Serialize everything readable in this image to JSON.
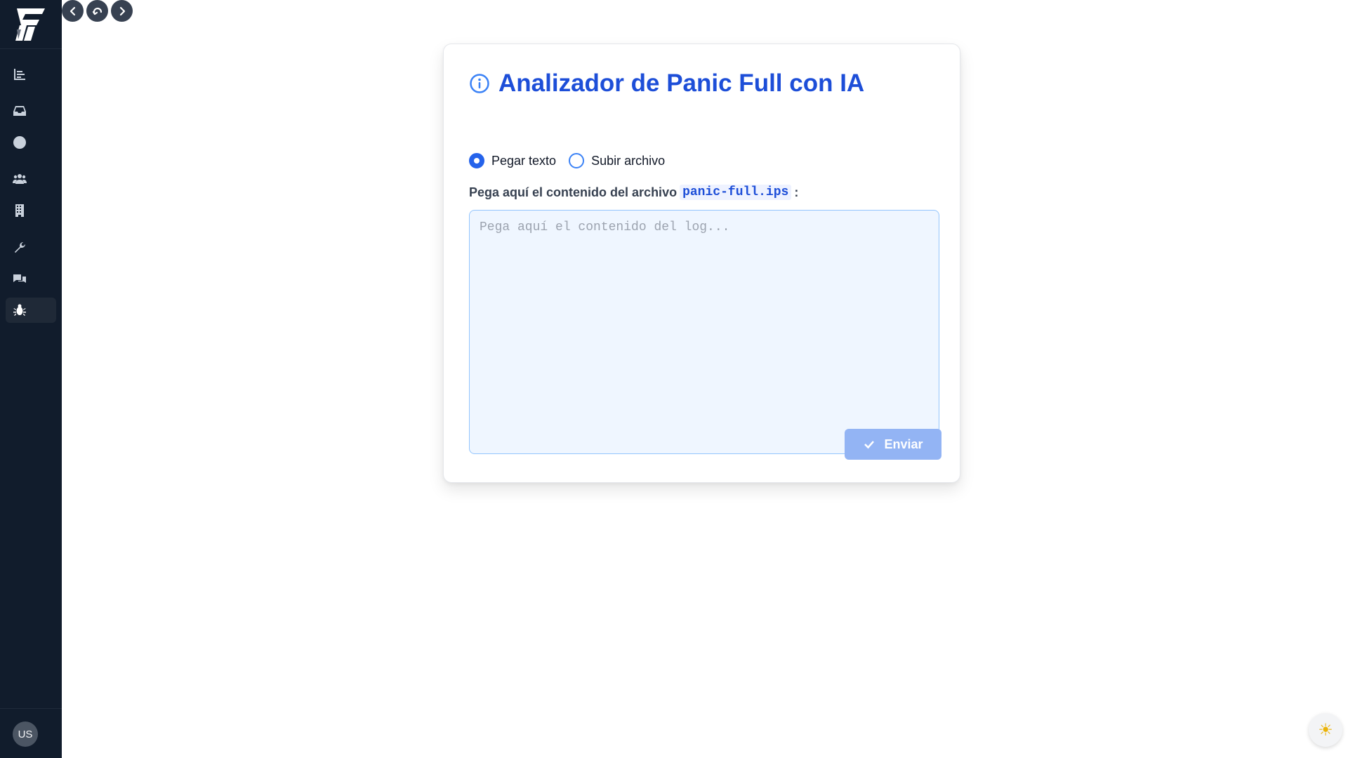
{
  "sidebar": {
    "items": [
      {
        "icon": "chart-icon"
      },
      {
        "icon": "inbox-icon"
      },
      {
        "icon": "clock-icon"
      },
      {
        "icon": "users-icon"
      },
      {
        "icon": "building-icon"
      },
      {
        "icon": "wrench-icon"
      },
      {
        "icon": "comments-icon"
      },
      {
        "icon": "bug-icon",
        "active": true
      }
    ],
    "avatar": "US"
  },
  "analyzer": {
    "title": "Analizador de Panic Full con IA",
    "modes": {
      "paste": "Pegar texto",
      "upload": "Subir archivo",
      "selected": "paste"
    },
    "prompt_prefix": "Pega aquí el contenido del archivo",
    "prompt_file": "panic-full.ips",
    "prompt_suffix": ":",
    "textarea": {
      "value": "",
      "placeholder": "Pega aquí el contenido del log..."
    },
    "submit_label": "Enviar"
  },
  "theme_toggle": {
    "icon": "sun-icon"
  },
  "colors": {
    "sidebar_bg": "#111c2c",
    "accent": "#1d4ed8",
    "submit_disabled": "#93b4f4"
  }
}
